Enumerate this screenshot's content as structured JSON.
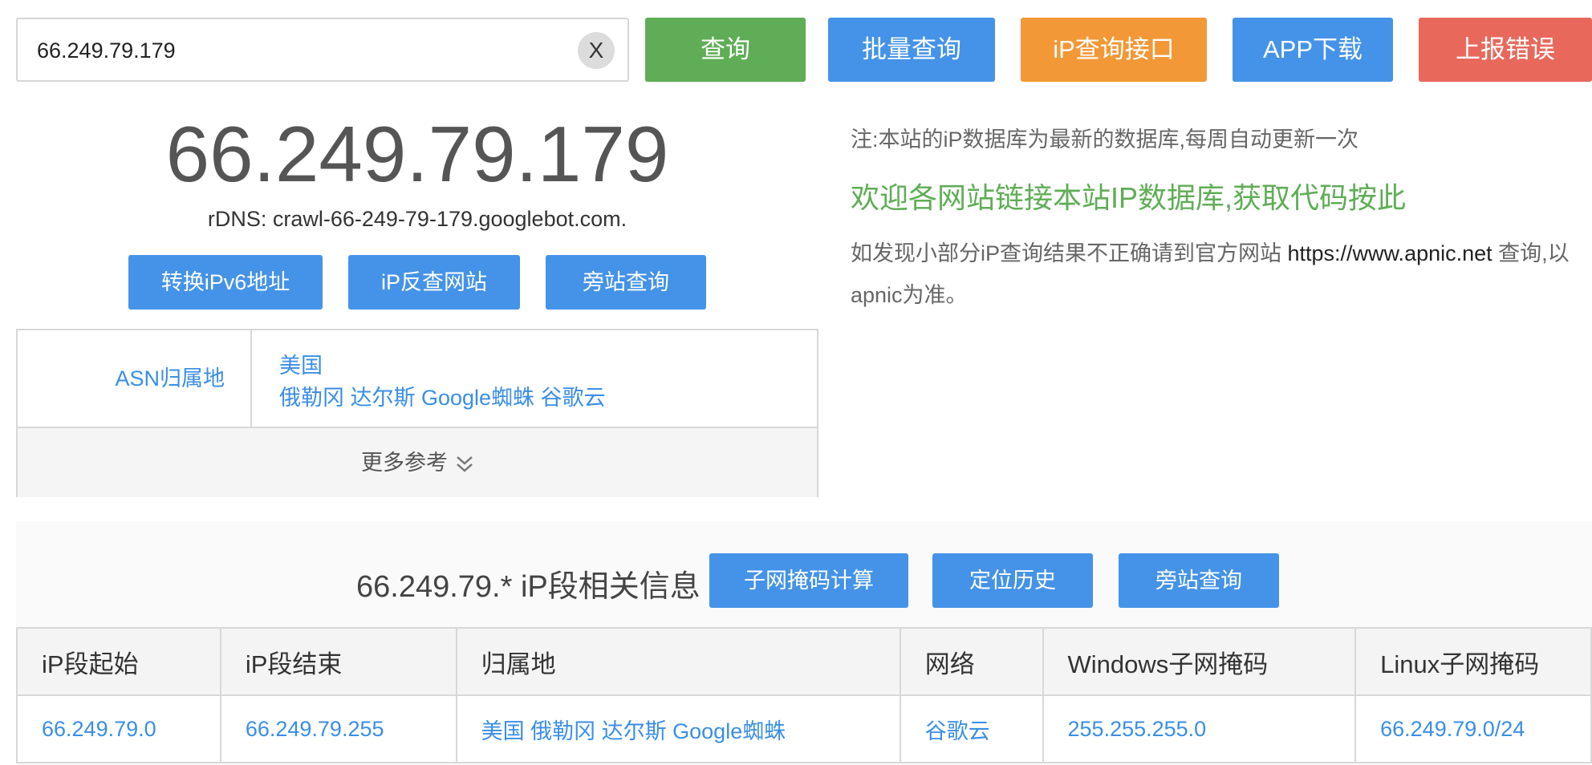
{
  "search": {
    "value": "66.249.79.179",
    "clear_label": "X"
  },
  "toolbar": {
    "query": "查询",
    "batch_query": "批量查询",
    "api": "iP查询接口",
    "app_download": "APP下载",
    "report_error": "上报错误"
  },
  "result": {
    "ip": "66.249.79.179",
    "rdns": "rDNS: crawl-66-249-79-179.googlebot.com.",
    "actions": {
      "ipv6": "转换iPv6地址",
      "reverse": "iP反查网站",
      "side": "旁站查询"
    },
    "asn_label": "ASN归属地",
    "asn_line1": "美国",
    "asn_line2": "俄勒冈 达尔斯 Google蜘蛛 谷歌云",
    "more": "更多参考"
  },
  "notes": {
    "line1": "注:本站的iP数据库为最新的数据库,每周自动更新一次",
    "line2": "欢迎各网站链接本站IP数据库,获取代码按此",
    "line3_pre": "如发现小部分iP查询结果不正确请到官方网站 ",
    "line3_url": "https://www.apnic.net",
    "line3_post": " 查询,以",
    "line4": "apnic为准。"
  },
  "segment": {
    "title": "66.249.79.* iP段相关信息",
    "buttons": {
      "subnet": "子网掩码计算",
      "history": "定位历史",
      "side": "旁站查询"
    },
    "headers": [
      "iP段起始",
      "iP段结束",
      "归属地",
      "网络",
      "Windows子网掩码",
      "Linux子网掩码"
    ],
    "row": [
      "66.249.79.0",
      "66.249.79.255",
      "美国 俄勒冈 达尔斯 Google蜘蛛",
      "谷歌云",
      "255.255.255.0",
      "66.249.79.0/24"
    ]
  },
  "colors": {
    "green": "#5fad56",
    "blue": "#4593e8",
    "orange": "#f29836",
    "red": "#e8695c",
    "link": "#3a8ee6"
  },
  "icons": {
    "more": "double-chevron-down-icon",
    "clear": "close-icon"
  }
}
